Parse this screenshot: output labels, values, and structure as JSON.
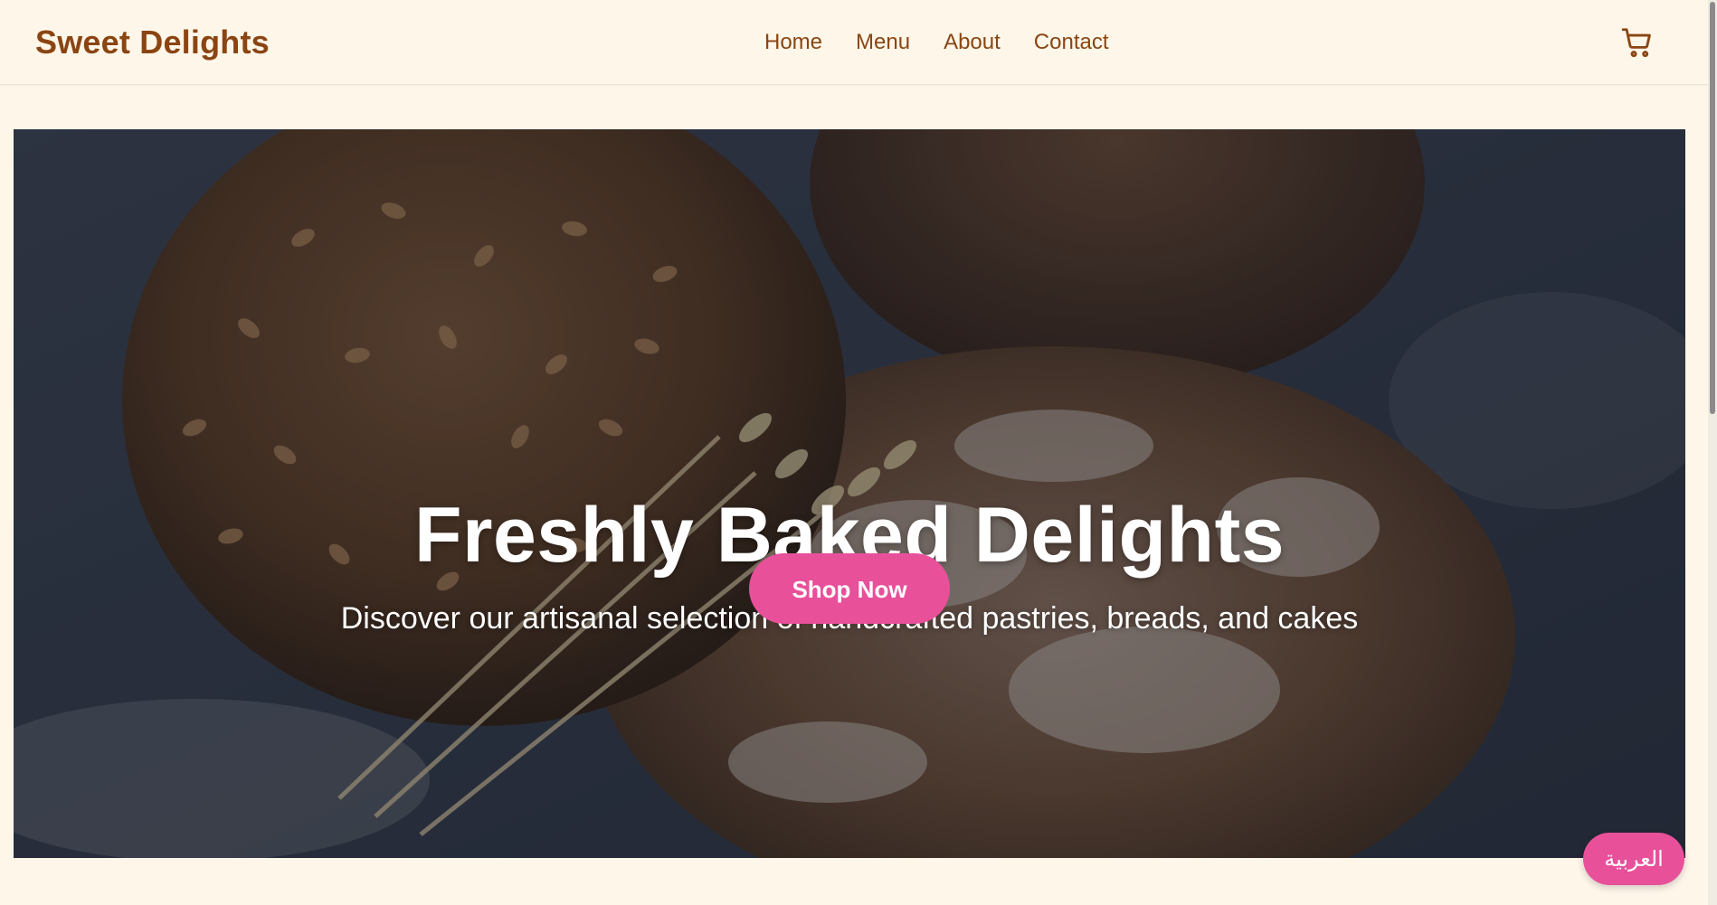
{
  "header": {
    "logo": "Sweet Delights",
    "nav": [
      {
        "label": "Home"
      },
      {
        "label": "Menu"
      },
      {
        "label": "About"
      },
      {
        "label": "Contact"
      }
    ],
    "cart_icon": "shopping-cart-icon"
  },
  "hero": {
    "title": "Freshly Baked Delights",
    "subtitle": "Discover our artisanal selection of handcrafted pastries, breads, and cakes",
    "cta_label": "Shop Now",
    "image": "bread-loaves-with-wheat-photo"
  },
  "language_toggle": {
    "label": "العربية"
  },
  "colors": {
    "background": "#fef6e9",
    "brand": "#8a4512",
    "accent": "#e8509a"
  }
}
